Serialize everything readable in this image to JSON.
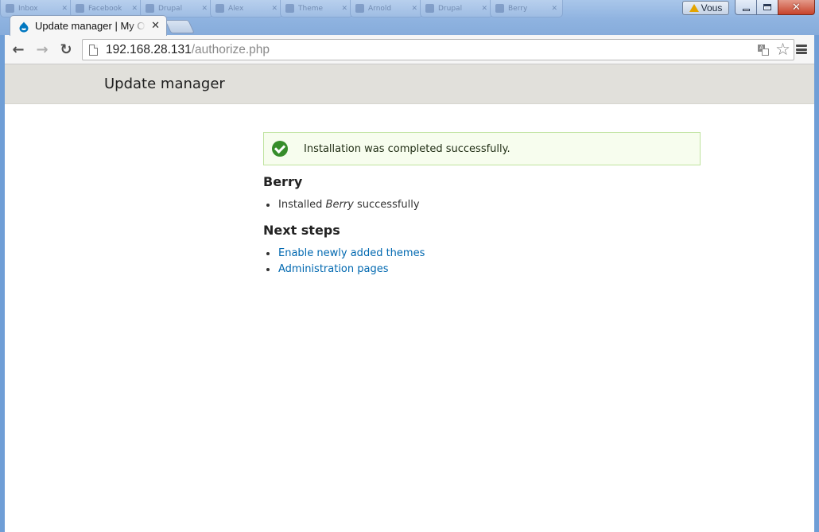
{
  "browser": {
    "background_tabs": [
      "Inbox",
      "Facebook",
      "Drupal",
      "Alex",
      "Theme",
      "Arnold",
      "Drupal",
      "Berry"
    ],
    "profile_label": "Vous",
    "active_tab": {
      "title": "Update manager | My Own Site",
      "close_glyph": "✕"
    },
    "nav": {
      "back_glyph": "←",
      "forward_glyph": "→",
      "reload_glyph": "↻"
    },
    "address": {
      "host": "192.168.28.131",
      "path": "/authorize.php"
    },
    "star_glyph": "☆",
    "window_buttons": {
      "close_glyph": "✕"
    }
  },
  "page": {
    "site_name": "Update manager",
    "status_message": "Installation was completed successfully.",
    "project_heading": "Berry",
    "install_result": {
      "prefix": "Installed",
      "name": "Berry",
      "suffix": "successfully"
    },
    "next_steps_heading": "Next steps",
    "next_steps": [
      "Enable newly added themes",
      "Administration pages"
    ]
  },
  "colors": {
    "link": "#0068b0",
    "status_bg": "#f7fdee",
    "status_border": "#bfe39f",
    "success_icon": "#368d2a",
    "header_bg": "#e1e0db"
  }
}
